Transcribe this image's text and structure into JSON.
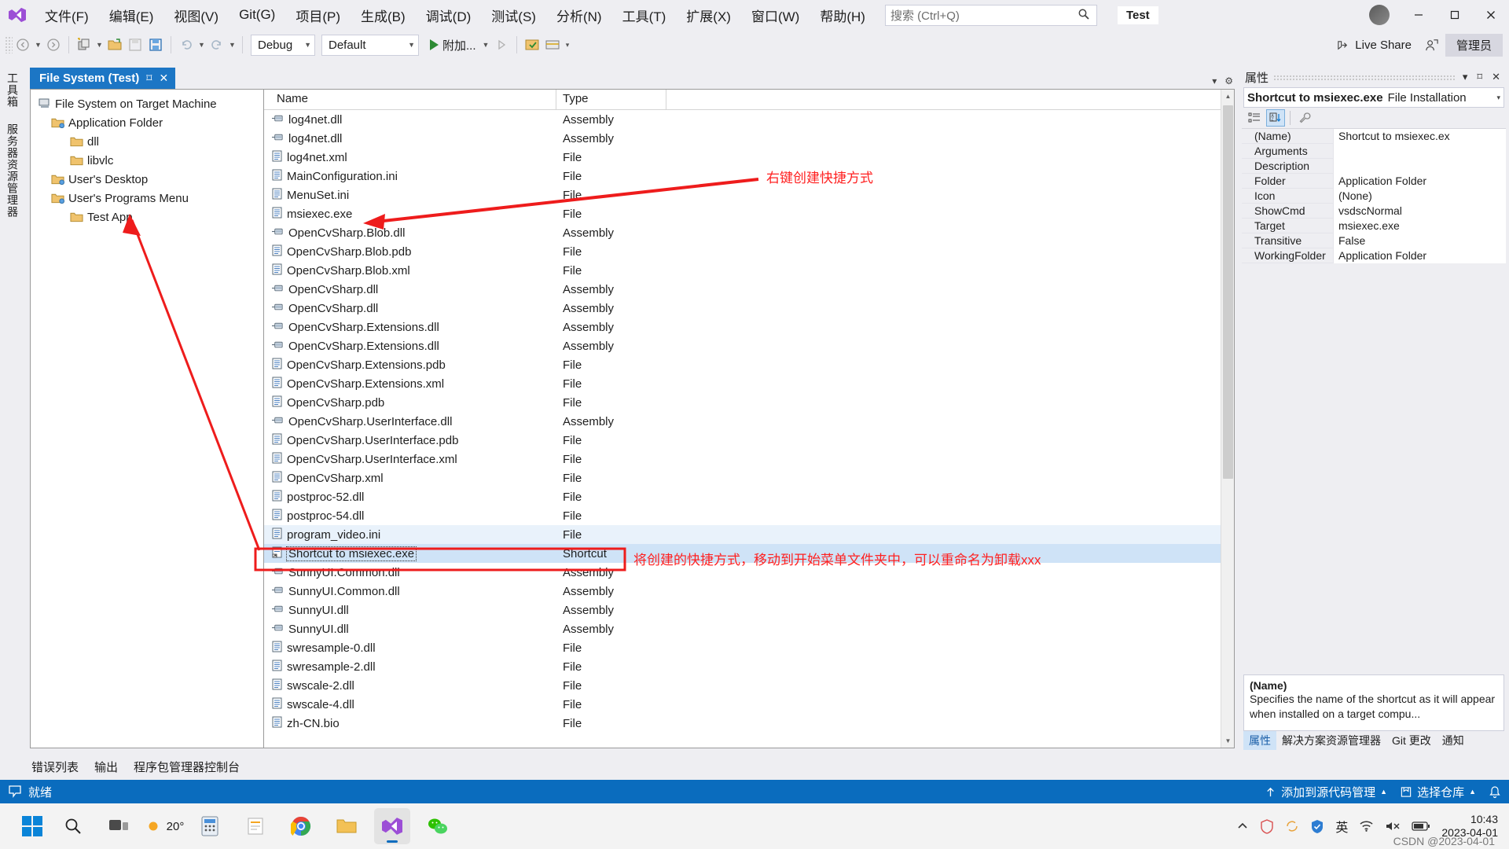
{
  "window": {
    "solution_name": "Test",
    "account_label": "管理员",
    "live_share": "Live Share"
  },
  "menu": {
    "items": [
      {
        "label": "文件(F)"
      },
      {
        "label": "编辑(E)"
      },
      {
        "label": "视图(V)"
      },
      {
        "label": "Git(G)"
      },
      {
        "label": "项目(P)"
      },
      {
        "label": "生成(B)"
      },
      {
        "label": "调试(D)"
      },
      {
        "label": "测试(S)"
      },
      {
        "label": "分析(N)"
      },
      {
        "label": "工具(T)"
      },
      {
        "label": "扩展(X)"
      },
      {
        "label": "窗口(W)"
      },
      {
        "label": "帮助(H)"
      }
    ]
  },
  "search": {
    "placeholder": "搜索 (Ctrl+Q)",
    "value": ""
  },
  "toolbar": {
    "config_value": "Debug",
    "platform_value": "Default",
    "run_label": "附加..."
  },
  "left_tabs": [
    {
      "label": "工具箱"
    },
    {
      "label": "服务器资源管理器"
    }
  ],
  "document": {
    "tab_title": "File System (Test)",
    "tree": [
      {
        "label": "File System on Target Machine",
        "indent": 0,
        "icon": "computer-icon"
      },
      {
        "label": "Application Folder",
        "indent": 1,
        "icon": "special-folder-icon"
      },
      {
        "label": "dll",
        "indent": 2,
        "icon": "folder-icon"
      },
      {
        "label": "libvlc",
        "indent": 2,
        "icon": "folder-icon"
      },
      {
        "label": "User's Desktop",
        "indent": 1,
        "icon": "special-folder-icon"
      },
      {
        "label": "User's Programs Menu",
        "indent": 1,
        "icon": "special-folder-icon"
      },
      {
        "label": "Test App",
        "indent": 2,
        "icon": "folder-icon"
      }
    ],
    "columns": [
      "Name",
      "Type"
    ],
    "rows": [
      {
        "name": "log4net.dll",
        "type": "Assembly",
        "icon": "assembly-icon"
      },
      {
        "name": "log4net.dll",
        "type": "Assembly",
        "icon": "assembly-icon"
      },
      {
        "name": "log4net.xml",
        "type": "File",
        "icon": "file-icon"
      },
      {
        "name": "MainConfiguration.ini",
        "type": "File",
        "icon": "file-icon"
      },
      {
        "name": "MenuSet.ini",
        "type": "File",
        "icon": "file-icon"
      },
      {
        "name": "msiexec.exe",
        "type": "File",
        "icon": "file-icon"
      },
      {
        "name": "OpenCvSharp.Blob.dll",
        "type": "Assembly",
        "icon": "assembly-icon"
      },
      {
        "name": "OpenCvSharp.Blob.pdb",
        "type": "File",
        "icon": "file-icon"
      },
      {
        "name": "OpenCvSharp.Blob.xml",
        "type": "File",
        "icon": "file-icon"
      },
      {
        "name": "OpenCvSharp.dll",
        "type": "Assembly",
        "icon": "assembly-icon"
      },
      {
        "name": "OpenCvSharp.dll",
        "type": "Assembly",
        "icon": "assembly-icon"
      },
      {
        "name": "OpenCvSharp.Extensions.dll",
        "type": "Assembly",
        "icon": "assembly-icon"
      },
      {
        "name": "OpenCvSharp.Extensions.dll",
        "type": "Assembly",
        "icon": "assembly-icon"
      },
      {
        "name": "OpenCvSharp.Extensions.pdb",
        "type": "File",
        "icon": "file-icon"
      },
      {
        "name": "OpenCvSharp.Extensions.xml",
        "type": "File",
        "icon": "file-icon"
      },
      {
        "name": "OpenCvSharp.pdb",
        "type": "File",
        "icon": "file-icon"
      },
      {
        "name": "OpenCvSharp.UserInterface.dll",
        "type": "Assembly",
        "icon": "assembly-icon"
      },
      {
        "name": "OpenCvSharp.UserInterface.pdb",
        "type": "File",
        "icon": "file-icon"
      },
      {
        "name": "OpenCvSharp.UserInterface.xml",
        "type": "File",
        "icon": "file-icon"
      },
      {
        "name": "OpenCvSharp.xml",
        "type": "File",
        "icon": "file-icon"
      },
      {
        "name": "postproc-52.dll",
        "type": "File",
        "icon": "file-icon"
      },
      {
        "name": "postproc-54.dll",
        "type": "File",
        "icon": "file-icon"
      },
      {
        "name": "program_video.ini",
        "type": "File",
        "icon": "file-icon",
        "state": "lite"
      },
      {
        "name": "Shortcut to msiexec.exe",
        "type": "Shortcut",
        "icon": "shortcut-icon",
        "state": "selected"
      },
      {
        "name": "SunnyUI.Common.dll",
        "type": "Assembly",
        "icon": "assembly-icon"
      },
      {
        "name": "SunnyUI.Common.dll",
        "type": "Assembly",
        "icon": "assembly-icon"
      },
      {
        "name": "SunnyUI.dll",
        "type": "Assembly",
        "icon": "assembly-icon"
      },
      {
        "name": "SunnyUI.dll",
        "type": "Assembly",
        "icon": "assembly-icon"
      },
      {
        "name": "swresample-0.dll",
        "type": "File",
        "icon": "file-icon"
      },
      {
        "name": "swresample-2.dll",
        "type": "File",
        "icon": "file-icon"
      },
      {
        "name": "swscale-2.dll",
        "type": "File",
        "icon": "file-icon"
      },
      {
        "name": "swscale-4.dll",
        "type": "File",
        "icon": "file-icon"
      },
      {
        "name": "zh-CN.bio",
        "type": "File",
        "icon": "file-icon"
      }
    ]
  },
  "annotations": [
    {
      "id": "a1",
      "text": "右键创建快捷方式",
      "color": "#ff2020"
    },
    {
      "id": "a2",
      "text": "将创建的快捷方式，移动到开始菜单文件夹中，可以重命名为卸载xxx",
      "color": "#ff2020"
    }
  ],
  "properties": {
    "panel_title": "属性",
    "object_name": "Shortcut to msiexec.exe",
    "object_class": "File Installation",
    "rows": [
      {
        "key": "(Name)",
        "value": "Shortcut to msiexec.ex",
        "selected": true
      },
      {
        "key": "Arguments",
        "value": ""
      },
      {
        "key": "Description",
        "value": ""
      },
      {
        "key": "Folder",
        "value": "Application Folder"
      },
      {
        "key": "Icon",
        "value": "(None)"
      },
      {
        "key": "ShowCmd",
        "value": "vsdscNormal"
      },
      {
        "key": "Target",
        "value": "msiexec.exe"
      },
      {
        "key": "Transitive",
        "value": "False"
      },
      {
        "key": "WorkingFolder",
        "value": "Application Folder"
      }
    ],
    "desc_title": "(Name)",
    "desc_body": "Specifies the name of the shortcut as it will appear when installed on a target compu...",
    "tabs": [
      {
        "label": "属性",
        "active": true
      },
      {
        "label": "解决方案资源管理器",
        "active": false
      },
      {
        "label": "Git 更改",
        "active": false
      },
      {
        "label": "通知",
        "active": false
      }
    ]
  },
  "bottom_tabs": [
    {
      "label": "错误列表"
    },
    {
      "label": "输出"
    },
    {
      "label": "程序包管理器控制台"
    }
  ],
  "statusbar": {
    "status": "就绪",
    "source_control": "添加到源代码管理",
    "repo": "选择仓库"
  },
  "taskbar": {
    "weather_temp": "20°",
    "clock_time": "10:43",
    "clock_date": "2023-04-01",
    "language": "英",
    "watermark": "CSDN @2023-04-01"
  },
  "colors": {
    "accent_blue": "#0a6cbe",
    "tab_blue": "#1c76c5",
    "selection": "#cfe3f7",
    "annotation_red": "#ff2020",
    "chrome_bg": "#eeeef2"
  }
}
